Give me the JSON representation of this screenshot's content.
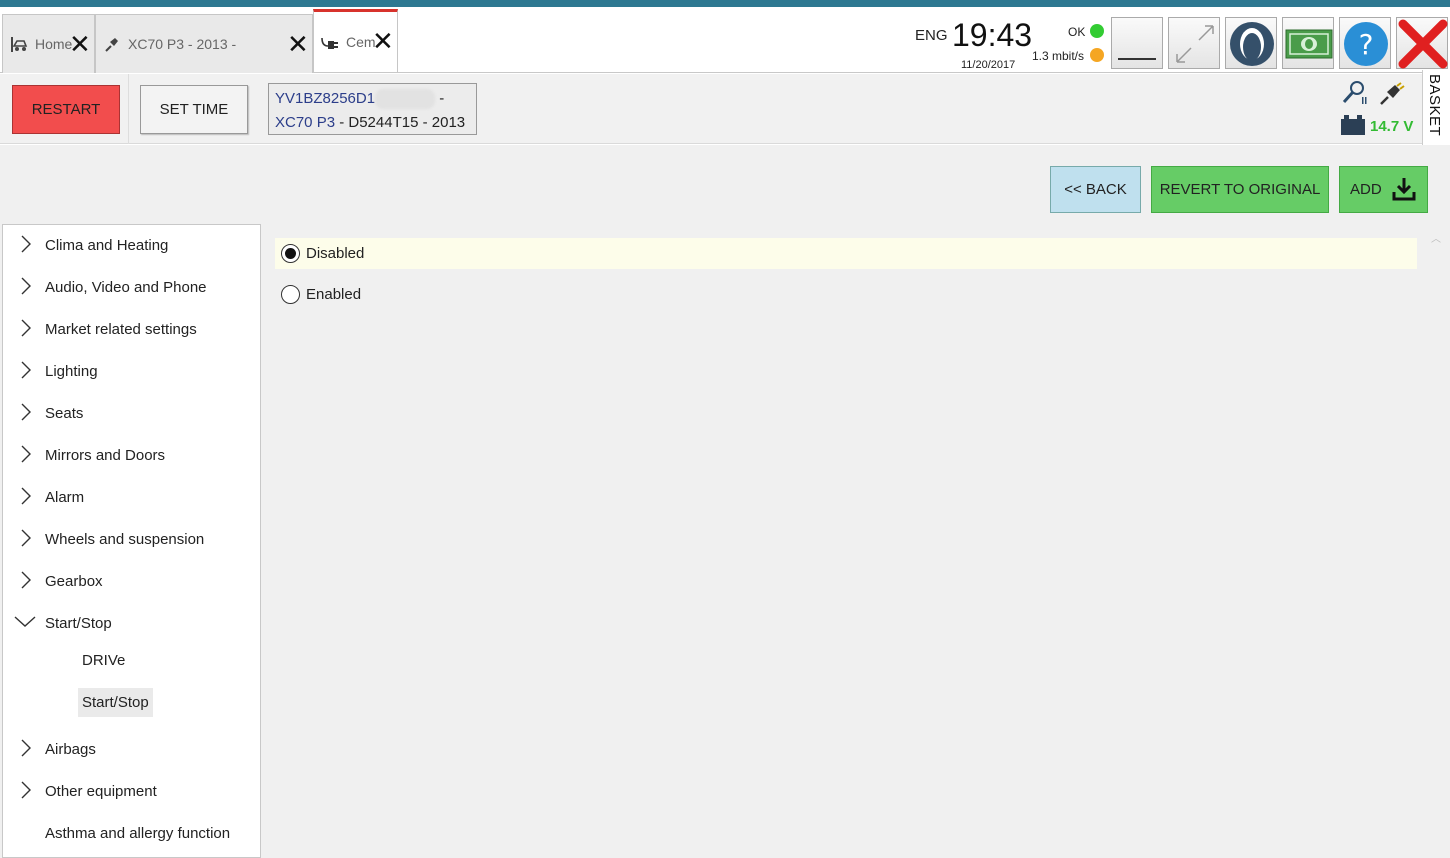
{
  "tabs": [
    {
      "label": "Home",
      "icon": "car-lift-icon"
    },
    {
      "label": "XC70 P3 - 2013 -",
      "icon": "plug-icon"
    },
    {
      "label": "Cem",
      "icon": "connector-icon"
    }
  ],
  "status": {
    "language": "ENG",
    "time": "19:43",
    "date": "11/20/2017",
    "ok_label": "OK",
    "rate_label": "1.3 mbit/s",
    "ok_color": "#33cc33",
    "rate_color": "#f5a623"
  },
  "tray_buttons": [
    "minimize-icon",
    "resize-icon",
    "user-icon",
    "money-icon",
    "help-icon",
    "close-icon"
  ],
  "basket_label": "BASKET",
  "toolbar": {
    "restart_label": "RESTART",
    "settime_label": "SET TIME",
    "vin_prefix": "YV1BZ8256D1",
    "vin_suffix": "-",
    "model": "XC70 P3",
    "model_rest": " - D5244T15 - 2013",
    "voltage": "14.7 V"
  },
  "actions": {
    "back_label": "<< BACK",
    "revert_label": "REVERT TO ORIGINAL",
    "add_label": "ADD"
  },
  "tree": [
    {
      "label": "Clima and Heating",
      "state": "collapsed"
    },
    {
      "label": "Audio, Video and Phone",
      "state": "collapsed"
    },
    {
      "label": "Market related settings",
      "state": "collapsed"
    },
    {
      "label": "Lighting",
      "state": "collapsed"
    },
    {
      "label": "Seats",
      "state": "collapsed"
    },
    {
      "label": "Mirrors and Doors",
      "state": "collapsed"
    },
    {
      "label": "Alarm",
      "state": "collapsed"
    },
    {
      "label": "Wheels and suspension",
      "state": "collapsed"
    },
    {
      "label": "Gearbox",
      "state": "collapsed"
    },
    {
      "label": "Start/Stop",
      "state": "expanded"
    },
    {
      "label": "DRIVe",
      "state": "child"
    },
    {
      "label": "Start/Stop",
      "state": "child-selected"
    },
    {
      "label": "Airbags",
      "state": "collapsed"
    },
    {
      "label": "Other equipment",
      "state": "collapsed"
    },
    {
      "label": "Asthma and allergy function",
      "state": "leaf"
    }
  ],
  "options": [
    {
      "label": "Disabled",
      "checked": true
    },
    {
      "label": "Enabled",
      "checked": false
    }
  ]
}
